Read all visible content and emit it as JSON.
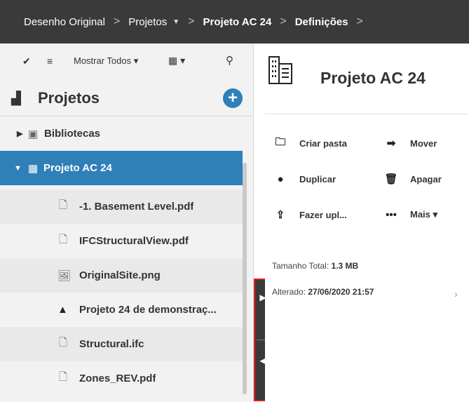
{
  "breadcrumb": {
    "items": [
      {
        "label": "Desenho Original"
      },
      {
        "label": "Projetos"
      },
      {
        "label": "Projeto AC 24"
      },
      {
        "label": "Definições"
      }
    ],
    "separator": ">"
  },
  "toolbar": {
    "check_icon": "✔",
    "list_icon": "≡",
    "filter_label": "Mostrar Todos ▾",
    "calendar_icon": "▦ ▾",
    "search_icon": "⚲"
  },
  "projects_header": {
    "title": "Projetos",
    "add_icon": "+"
  },
  "tree": {
    "items": [
      {
        "label": "Bibliotecas",
        "arrow": "▶",
        "icon": "▣"
      },
      {
        "label": "Projeto AC 24",
        "arrow": "▼",
        "icon": "▦"
      },
      {
        "label": "-1. Basement Level.pdf",
        "icon": "🗋"
      },
      {
        "label": "IFCStructuralView.pdf",
        "icon": "🗋"
      },
      {
        "label": "OriginalSite.png",
        "icon": "🖼"
      },
      {
        "label": "Projeto 24 de demonstraç...",
        "icon": "▲"
      },
      {
        "label": "Structural.ifc",
        "icon": "🗋"
      },
      {
        "label": "Zones_REV.pdf",
        "icon": "🗋"
      }
    ]
  },
  "handle": {
    "expand_icon": "▶",
    "collapse_icon": "◀"
  },
  "details": {
    "title": "Projeto AC 24",
    "actions": [
      {
        "label": "Criar pasta",
        "icon": "🗀"
      },
      {
        "label": "Mover",
        "icon": "➡"
      },
      {
        "label": "Duplicar",
        "icon": "●"
      },
      {
        "label": "Apagar",
        "icon": "🗑"
      },
      {
        "label": "Fazer upl...",
        "icon": "⇪"
      },
      {
        "label": "Mais ▾",
        "icon": "•••"
      }
    ],
    "total_size_label": "Tamanho Total:",
    "total_size_value": "1.3 MB",
    "modified_label": "Alterado:",
    "modified_value": "27/06/2020 21:57",
    "chevron": "›"
  },
  "colors": {
    "accent": "#2f7fb8",
    "topbar": "#3a3a3a",
    "highlight_border": "#e02020"
  }
}
